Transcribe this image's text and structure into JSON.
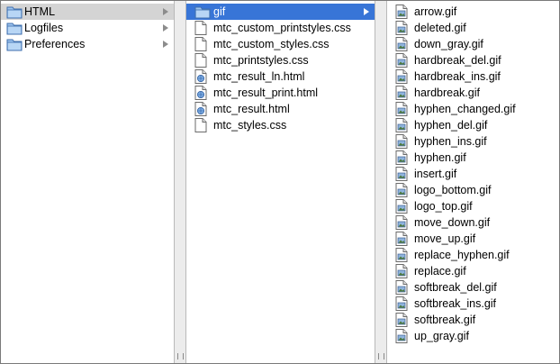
{
  "column1": {
    "items": [
      {
        "label": "HTML",
        "type": "folder",
        "has_children": true,
        "state": "selected-inactive"
      },
      {
        "label": "Logfiles",
        "type": "folder",
        "has_children": true,
        "state": ""
      },
      {
        "label": "Preferences",
        "type": "folder",
        "has_children": true,
        "state": ""
      }
    ]
  },
  "column2": {
    "items": [
      {
        "label": "gif",
        "type": "folder",
        "has_children": true,
        "state": "selected"
      },
      {
        "label": "mtc_custom_printstyles.css",
        "type": "doc"
      },
      {
        "label": "mtc_custom_styles.css",
        "type": "doc"
      },
      {
        "label": "mtc_printstyles.css",
        "type": "doc"
      },
      {
        "label": "mtc_result_ln.html",
        "type": "html"
      },
      {
        "label": "mtc_result_print.html",
        "type": "html"
      },
      {
        "label": "mtc_result.html",
        "type": "html"
      },
      {
        "label": "mtc_styles.css",
        "type": "doc"
      }
    ]
  },
  "column3": {
    "items": [
      {
        "label": "arrow.gif",
        "type": "image"
      },
      {
        "label": "deleted.gif",
        "type": "image"
      },
      {
        "label": "down_gray.gif",
        "type": "image"
      },
      {
        "label": "hardbreak_del.gif",
        "type": "image"
      },
      {
        "label": "hardbreak_ins.gif",
        "type": "image"
      },
      {
        "label": "hardbreak.gif",
        "type": "image"
      },
      {
        "label": "hyphen_changed.gif",
        "type": "image"
      },
      {
        "label": "hyphen_del.gif",
        "type": "image"
      },
      {
        "label": "hyphen_ins.gif",
        "type": "image"
      },
      {
        "label": "hyphen.gif",
        "type": "image"
      },
      {
        "label": "insert.gif",
        "type": "image"
      },
      {
        "label": "logo_bottom.gif",
        "type": "image"
      },
      {
        "label": "logo_top.gif",
        "type": "image"
      },
      {
        "label": "move_down.gif",
        "type": "image"
      },
      {
        "label": "move_up.gif",
        "type": "image"
      },
      {
        "label": "replace_hyphen.gif",
        "type": "image"
      },
      {
        "label": "replace.gif",
        "type": "image"
      },
      {
        "label": "softbreak_del.gif",
        "type": "image"
      },
      {
        "label": "softbreak_ins.gif",
        "type": "image"
      },
      {
        "label": "softbreak.gif",
        "type": "image"
      },
      {
        "label": "up_gray.gif",
        "type": "image"
      }
    ]
  },
  "colors": {
    "selection": "#3875d7",
    "selection_inactive": "#d4d4d4",
    "folder": "#6fa3dc"
  }
}
